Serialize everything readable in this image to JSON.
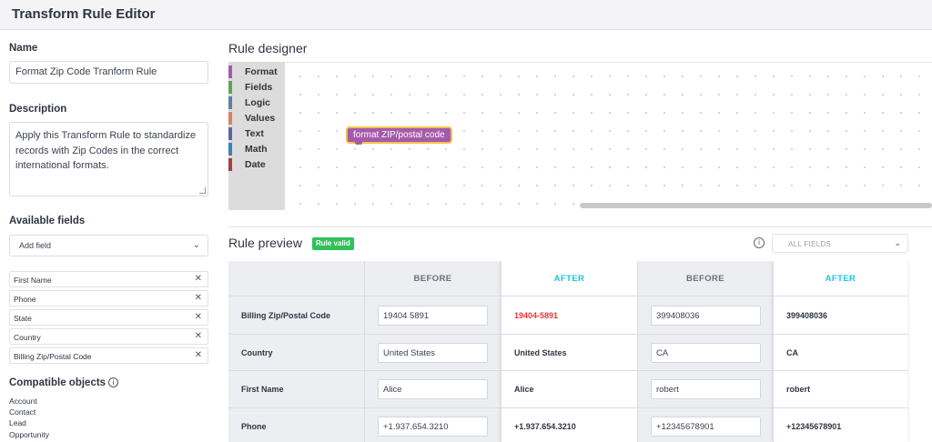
{
  "app": {
    "title": "Transform Rule Editor"
  },
  "left": {
    "name_label": "Name",
    "name_value": "Format Zip Code Tranform Rule",
    "description_label": "Description",
    "description_value": "Apply this Transform Rule to standardize records with Zip Codes in the correct international formats.",
    "available_fields_label": "Available fields",
    "add_field_placeholder": "Add field",
    "fields": [
      "First Name",
      "Phone",
      "State",
      "Country",
      "Billing Zip/Postal Code"
    ],
    "compatible_label": "Compatible objects",
    "objects": [
      "Account",
      "Contact",
      "Lead",
      "Opportunity"
    ]
  },
  "designer": {
    "title": "Rule designer",
    "palette": [
      {
        "label": "Format",
        "color": "#a55bab"
      },
      {
        "label": "Fields",
        "color": "#5ba55b"
      },
      {
        "label": "Logic",
        "color": "#5b80a5"
      },
      {
        "label": "Values",
        "color": "#d9825b"
      },
      {
        "label": "Text",
        "color": "#5b67a5"
      },
      {
        "label": "Math",
        "color": "#3f7fc0"
      },
      {
        "label": "Date",
        "color": "#a5403f"
      }
    ],
    "block_label": "format ZIP/postal code"
  },
  "preview": {
    "title": "Rule preview",
    "status_badge": "Rule valid",
    "fields_filter": "ALL FIELDS",
    "headers": {
      "before": "BEFORE",
      "after": "AFTER"
    },
    "rows": [
      {
        "label": "Billing Zip/Postal Code",
        "before1": "19404 5891",
        "after1": "19404-5891",
        "before2": "399408036",
        "after2": "399408036"
      },
      {
        "label": "Country",
        "before1": "United States",
        "after1": "United States",
        "before2": "CA",
        "after2": "CA"
      },
      {
        "label": "First Name",
        "before1": "Alice",
        "after1": "Alice",
        "before2": "robert",
        "after2": "robert"
      },
      {
        "label": "Phone",
        "before1": "+1.937.654.3210",
        "after1": "+1.937.654.3210",
        "before2": "+12345678901",
        "after2": "+12345678901"
      }
    ]
  },
  "colors": {
    "accent_after": "#1fc3dd",
    "error": "#e8353b",
    "valid": "#2fc25b",
    "block": "#a55bab",
    "block_border": "#f3c14b"
  }
}
